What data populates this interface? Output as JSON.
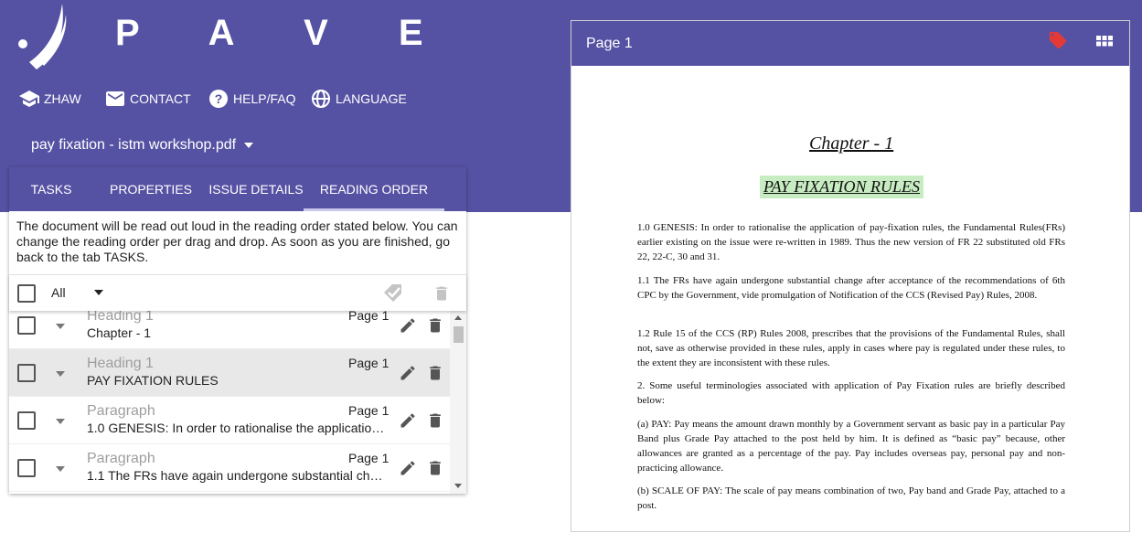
{
  "app": {
    "brand": "P A V E",
    "nav": [
      {
        "label": "ZHAW",
        "icon": "graduation-cap-icon"
      },
      {
        "label": "CONTACT",
        "icon": "mail-icon"
      },
      {
        "label": "HELP/FAQ",
        "icon": "help-circle-icon"
      },
      {
        "label": "LANGUAGE",
        "icon": "globe-icon"
      }
    ],
    "file_selector": {
      "value": "pay fixation - istm workshop.pdf",
      "icon": "caret-down-icon"
    }
  },
  "panel": {
    "tabs": [
      {
        "label": "TASKS"
      },
      {
        "label": "PROPERTIES"
      },
      {
        "label": "ISSUE DETAILS"
      },
      {
        "label": "READING ORDER",
        "active": true
      }
    ],
    "info": "The document will be read out loud in the reading order stated below. You can change the reading order per drag and drop. As soon as you are finished, go back to the tab TASKS.",
    "filter": {
      "value": "All"
    },
    "items": [
      {
        "type": "Heading 1",
        "text": "Chapter - 1",
        "page": "Page 1",
        "selected": false
      },
      {
        "type": "Heading 1",
        "text": "PAY FIXATION RULES",
        "page": "Page 1",
        "selected": true
      },
      {
        "type": "Paragraph",
        "text": "1.0 GENESIS: In order to rationalise the application of pay-fixation rules",
        "page": "Page 1",
        "selected": false
      },
      {
        "type": "Paragraph",
        "text": "1.1 The FRs have again undergone substantial change after acceptance",
        "page": "Page 1",
        "selected": false
      }
    ]
  },
  "document": {
    "title": "Page 1",
    "chapter": "Chapter - 1",
    "heading": "PAY FIXATION RULES",
    "paragraphs": [
      "1.0      GENESIS:  In order to rationalise the application of pay-fixation rules, the Fundamental Rules(FRs) earlier existing on the issue were re-written in 1989.  Thus the new version of FR 22 substituted old FRs 22, 22-C, 30 and 31.",
      "1.1      The FRs have again undergone substantial change after acceptance of the recommendations of 6th CPC by the Government, vide promulgation of Notification of the CCS (Revised Pay) Rules, 2008.",
      "1.2      Rule 15 of the CCS (RP) Rules 2008, prescribes that the provisions of the Fundamental Rules, shall not,  save as otherwise provided in these rules, apply in cases where pay is regulated under these rules, to the extent they are inconsistent with these rules.",
      "2.       Some useful terminologies associated with application of Pay Fixation rules are briefly described below:",
      "(a)      PAY:  Pay means the amount drawn monthly by a Government servant as basic pay in a particular Pay Band plus Grade Pay attached to the post held by him.  It is defined as “basic pay” because, other allowances are granted as a percentage of the pay.  Pay includes overseas pay, personal pay and non-practicing allowance.",
      "(b)      SCALE OF PAY:  The scale of pay means combination of two, Pay band and Grade Pay, attached to a post."
    ]
  },
  "colors": {
    "primary": "#5552a3",
    "tag": "#e53935",
    "highlight": "#c8ecc1"
  }
}
